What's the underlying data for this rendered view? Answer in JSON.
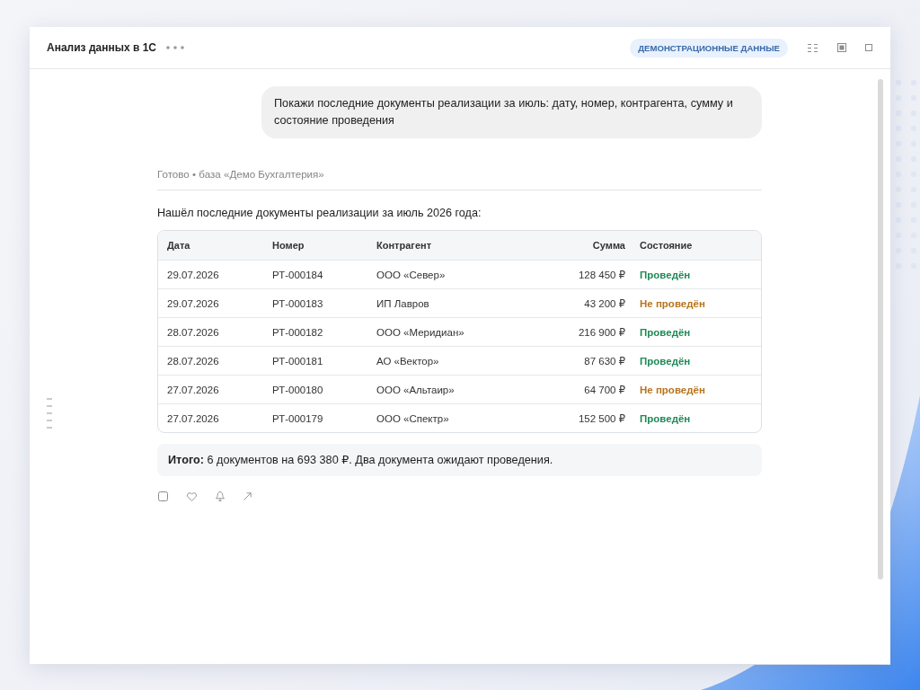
{
  "window": {
    "title": "Анализ данных в 1С",
    "badge": "ДЕМОНСТРАЦИОННЫЕ ДАННЫЕ"
  },
  "chat": {
    "user_message": "Покажи последние документы реализации за июль: дату, номер, контрагента, сумму и состояние проведения",
    "status": "Готово • база «Демо Бухгалтерия»",
    "intro": "Нашёл последние документы реализации за июль 2026 года:",
    "table": {
      "columns": [
        {
          "label": "Дата",
          "kind": "text"
        },
        {
          "label": "Номер",
          "kind": "text"
        },
        {
          "label": "Контрагент",
          "kind": "text"
        },
        {
          "label": "Сумма",
          "kind": "amount"
        },
        {
          "label": "Состояние",
          "kind": "status"
        }
      ],
      "rows": [
        {
          "cells": [
            "29.07.2026",
            "РТ-000184",
            "ООО «Север»",
            "128 450 ₽"
          ],
          "status": "Проведён",
          "posted": true
        },
        {
          "cells": [
            "29.07.2026",
            "РТ-000183",
            "ИП Лавров",
            "43 200 ₽"
          ],
          "status": "Не проведён",
          "posted": false
        },
        {
          "cells": [
            "28.07.2026",
            "РТ-000182",
            "ООО «Меридиан»",
            "216 900 ₽"
          ],
          "status": "Проведён",
          "posted": true
        },
        {
          "cells": [
            "28.07.2026",
            "РТ-000181",
            "АО «Вектор»",
            "87 630 ₽"
          ],
          "status": "Проведён",
          "posted": true
        },
        {
          "cells": [
            "27.07.2026",
            "РТ-000180",
            "ООО «Альтаир»",
            "64 700 ₽"
          ],
          "status": "Не проведён",
          "posted": false
        },
        {
          "cells": [
            "27.07.2026",
            "РТ-000179",
            "ООО «Спектр»",
            "152 500 ₽"
          ],
          "status": "Проведён",
          "posted": true
        }
      ]
    },
    "summary": "**Итого:** 6 документов на 693 380 ₽. Два документа ожидают проведения."
  }
}
